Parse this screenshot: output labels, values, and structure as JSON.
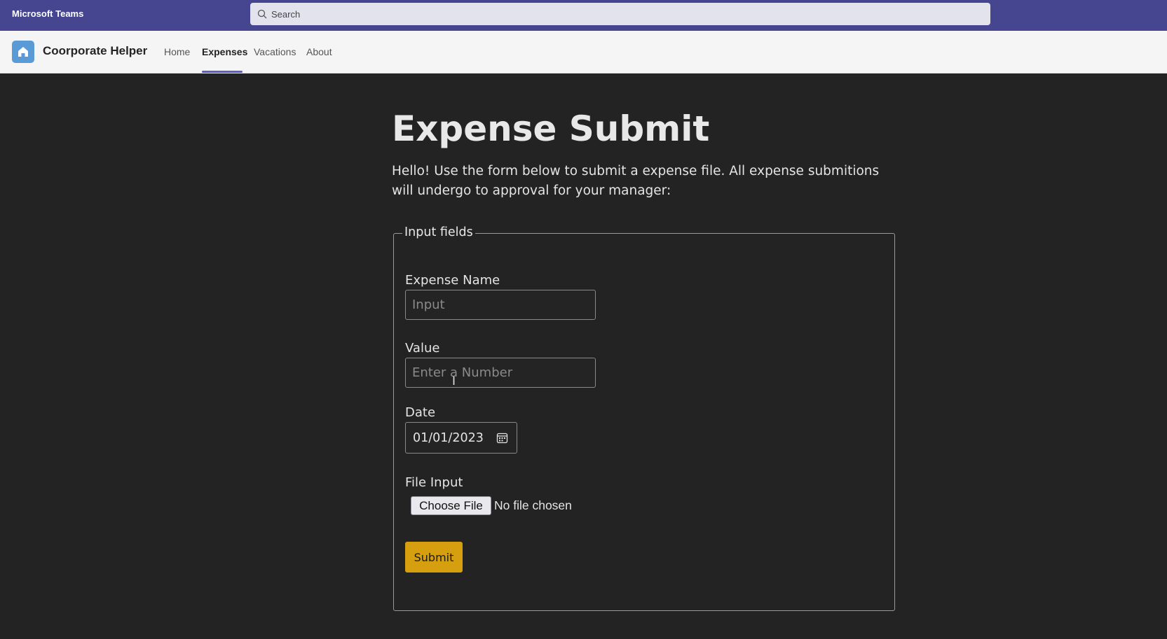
{
  "titlebar": {
    "app_name": "Microsoft Teams",
    "search_placeholder": "Search"
  },
  "appbar": {
    "title": "Coorporate Helper",
    "tabs": [
      {
        "label": "Home",
        "active": false
      },
      {
        "label": "Expenses",
        "active": true
      },
      {
        "label": "Vacations",
        "active": false
      },
      {
        "label": "About",
        "active": false
      }
    ]
  },
  "page": {
    "heading": "Expense Submit",
    "intro": "Hello! Use the form below to submit a expense file. All expense submitions will undergo to approval for your manager:",
    "fieldset_legend": "Input fields",
    "fields": {
      "expense_name_label": "Expense Name",
      "expense_name_placeholder": "Input",
      "value_label": "Value",
      "value_placeholder": "Enter a Number",
      "date_label": "Date",
      "date_value": "01/01/2023",
      "file_label": "File Input",
      "file_button": "Choose File",
      "file_status": "No file chosen"
    },
    "submit_label": "Submit"
  },
  "colors": {
    "titlebar": "#45468f",
    "accent": "#5b5fc7",
    "submit": "#d69f0f",
    "background": "#232323"
  }
}
